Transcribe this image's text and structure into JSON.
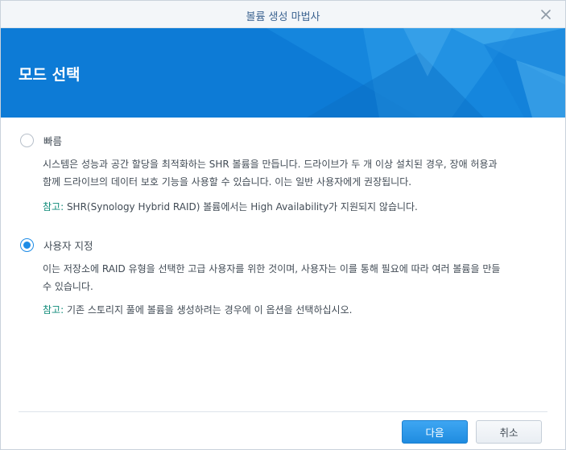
{
  "window": {
    "title": "볼륨 생성 마법사",
    "close_icon": "close-icon"
  },
  "banner": {
    "title": "모드 선택"
  },
  "options": [
    {
      "label": "빠름",
      "checked": false,
      "description_line1": "시스템은 성능과 공간 할당을 최적화하는 SHR 볼륨을 만듭니다. 드라이브가 두 개 이상 설치된 경우, 장애 허용과",
      "description_line2": "함께 드라이브의 데이터 보호 기능을 사용할 수 있습니다. 이는 일반 사용자에게 권장됩니다.",
      "note_prefix": "참고:",
      "note_text": " SHR(Synology Hybrid RAID) 볼륨에서는 High Availability가 지원되지 않습니다."
    },
    {
      "label": "사용자 지정",
      "checked": true,
      "description_line1": "이는 저장소에 RAID 유형을 선택한 고급 사용자를 위한 것이며, 사용자는 이를 통해 필요에 따라 여러 볼륨을 만들",
      "description_line2": "수 있습니다.",
      "note_prefix": "참고:",
      "note_text": " 기존 스토리지 풀에 볼륨을 생성하려는 경우에 이 옵션을 선택하십시오."
    }
  ],
  "footer": {
    "next_label": "다음",
    "cancel_label": "취소"
  },
  "colors": {
    "accent": "#1e8ce6",
    "banner": "#0f7fd8",
    "note": "#0e8a78"
  }
}
